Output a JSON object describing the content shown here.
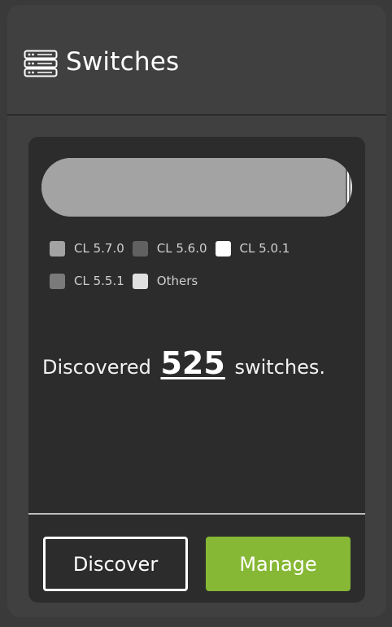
{
  "header": {
    "icon": "server-stack-icon",
    "title": "Switches"
  },
  "distribution": {
    "segments": [
      {
        "label": "CL 5.7.0",
        "color": "#a3a3a3",
        "fraction": 0.98
      },
      {
        "label": "CL 5.6.0",
        "color": "#616161",
        "fraction": 0.004
      },
      {
        "label": "CL 5.0.1",
        "color": "#ffffff",
        "fraction": 0.006
      },
      {
        "label": "CL 5.5.1",
        "color": "#7a7a7a",
        "fraction": 0.004
      },
      {
        "label": "Others",
        "color": "#e0e0e0",
        "fraction": 0.006
      }
    ]
  },
  "legend": {
    "items": [
      {
        "label": "CL 5.7.0",
        "color": "#a3a3a3"
      },
      {
        "label": "CL 5.6.0",
        "color": "#616161"
      },
      {
        "label": "CL 5.0.1",
        "color": "#ffffff"
      },
      {
        "label": "CL 5.5.1",
        "color": "#7a7a7a"
      },
      {
        "label": "Others",
        "color": "#e0e0e0"
      }
    ]
  },
  "summary": {
    "prefix": "Discovered",
    "count": "525",
    "suffix": "switches."
  },
  "actions": {
    "discover_label": "Discover",
    "manage_label": "Manage",
    "manage_color": "#86b835"
  }
}
